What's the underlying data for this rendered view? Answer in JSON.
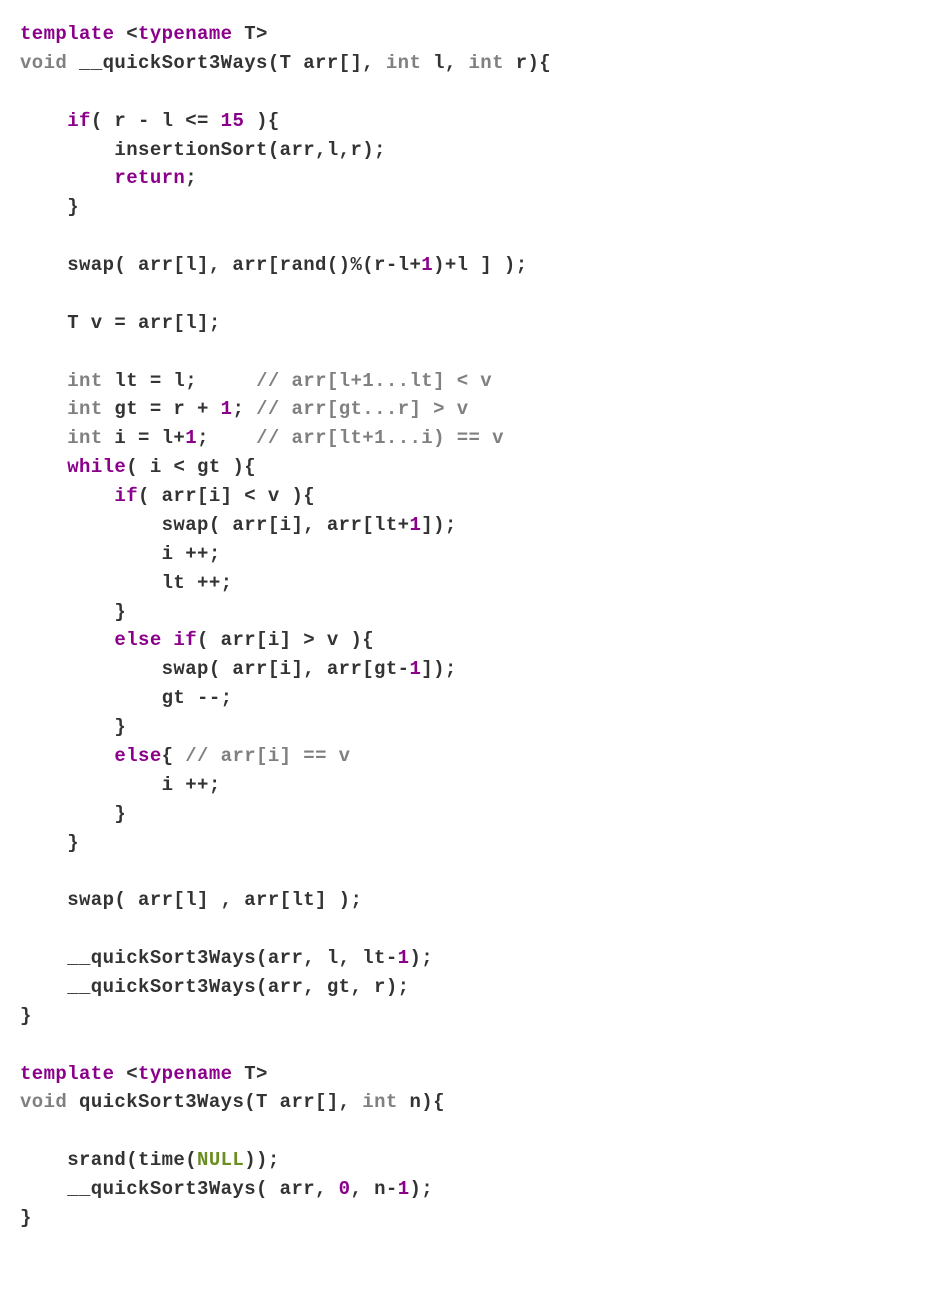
{
  "code": {
    "lines": [
      [
        [
          "kw",
          "template"
        ],
        [
          "txt",
          " <"
        ],
        [
          "kw",
          "typename"
        ],
        [
          "txt",
          " T>"
        ]
      ],
      [
        [
          "ty",
          "void"
        ],
        [
          "txt",
          " __quickSort3Ways(T arr[], "
        ],
        [
          "ty",
          "int"
        ],
        [
          "txt",
          " l, "
        ],
        [
          "ty",
          "int"
        ],
        [
          "txt",
          " r){"
        ]
      ],
      [
        [
          "txt",
          ""
        ]
      ],
      [
        [
          "txt",
          "    "
        ],
        [
          "kw",
          "if"
        ],
        [
          "txt",
          "( r - l <= "
        ],
        [
          "num",
          "15"
        ],
        [
          "txt",
          " ){"
        ]
      ],
      [
        [
          "txt",
          "        insertionSort(arr,l,r);"
        ]
      ],
      [
        [
          "txt",
          "        "
        ],
        [
          "kw",
          "return"
        ],
        [
          "txt",
          ";"
        ]
      ],
      [
        [
          "txt",
          "    }"
        ]
      ],
      [
        [
          "txt",
          ""
        ]
      ],
      [
        [
          "txt",
          "    swap( arr[l], arr[rand()%(r-l+"
        ],
        [
          "num",
          "1"
        ],
        [
          "txt",
          ")+l ] );"
        ]
      ],
      [
        [
          "txt",
          ""
        ]
      ],
      [
        [
          "txt",
          "    T v = arr[l];"
        ]
      ],
      [
        [
          "txt",
          ""
        ]
      ],
      [
        [
          "txt",
          "    "
        ],
        [
          "ty",
          "int"
        ],
        [
          "txt",
          " lt = l;     "
        ],
        [
          "cm",
          "// arr[l+1...lt] < v"
        ]
      ],
      [
        [
          "txt",
          "    "
        ],
        [
          "ty",
          "int"
        ],
        [
          "txt",
          " gt = r + "
        ],
        [
          "num",
          "1"
        ],
        [
          "txt",
          "; "
        ],
        [
          "cm",
          "// arr[gt...r] > v"
        ]
      ],
      [
        [
          "txt",
          "    "
        ],
        [
          "ty",
          "int"
        ],
        [
          "txt",
          " i = l+"
        ],
        [
          "num",
          "1"
        ],
        [
          "txt",
          ";    "
        ],
        [
          "cm",
          "// arr[lt+1...i) == v"
        ]
      ],
      [
        [
          "txt",
          "    "
        ],
        [
          "kw",
          "while"
        ],
        [
          "txt",
          "( i < gt ){"
        ]
      ],
      [
        [
          "txt",
          "        "
        ],
        [
          "kw",
          "if"
        ],
        [
          "txt",
          "( arr[i] < v ){"
        ]
      ],
      [
        [
          "txt",
          "            swap( arr[i], arr[lt+"
        ],
        [
          "num",
          "1"
        ],
        [
          "txt",
          "]);"
        ]
      ],
      [
        [
          "txt",
          "            i ++;"
        ]
      ],
      [
        [
          "txt",
          "            lt ++;"
        ]
      ],
      [
        [
          "txt",
          "        }"
        ]
      ],
      [
        [
          "txt",
          "        "
        ],
        [
          "kw",
          "else if"
        ],
        [
          "txt",
          "( arr[i] > v ){"
        ]
      ],
      [
        [
          "txt",
          "            swap( arr[i], arr[gt-"
        ],
        [
          "num",
          "1"
        ],
        [
          "txt",
          "]);"
        ]
      ],
      [
        [
          "txt",
          "            gt --;"
        ]
      ],
      [
        [
          "txt",
          "        }"
        ]
      ],
      [
        [
          "txt",
          "        "
        ],
        [
          "kw",
          "else"
        ],
        [
          "txt",
          "{ "
        ],
        [
          "cm",
          "// arr[i] == v"
        ]
      ],
      [
        [
          "txt",
          "            i ++;"
        ]
      ],
      [
        [
          "txt",
          "        }"
        ]
      ],
      [
        [
          "txt",
          "    }"
        ]
      ],
      [
        [
          "txt",
          ""
        ]
      ],
      [
        [
          "txt",
          "    swap( arr[l] , arr[lt] );"
        ]
      ],
      [
        [
          "txt",
          ""
        ]
      ],
      [
        [
          "txt",
          "    __quickSort3Ways(arr, l, lt-"
        ],
        [
          "num",
          "1"
        ],
        [
          "txt",
          ");"
        ]
      ],
      [
        [
          "txt",
          "    __quickSort3Ways(arr, gt, r);"
        ]
      ],
      [
        [
          "txt",
          "}"
        ]
      ],
      [
        [
          "txt",
          ""
        ]
      ],
      [
        [
          "kw",
          "template"
        ],
        [
          "txt",
          " <"
        ],
        [
          "kw",
          "typename"
        ],
        [
          "txt",
          " T>"
        ]
      ],
      [
        [
          "ty",
          "void"
        ],
        [
          "txt",
          " quickSort3Ways(T arr[], "
        ],
        [
          "ty",
          "int"
        ],
        [
          "txt",
          " n){"
        ]
      ],
      [
        [
          "txt",
          ""
        ]
      ],
      [
        [
          "txt",
          "    srand(time("
        ],
        [
          "nul",
          "NULL"
        ],
        [
          "txt",
          "));"
        ]
      ],
      [
        [
          "txt",
          "    __quickSort3Ways( arr, "
        ],
        [
          "num",
          "0"
        ],
        [
          "txt",
          ", n-"
        ],
        [
          "num",
          "1"
        ],
        [
          "txt",
          ");"
        ]
      ],
      [
        [
          "txt",
          "}"
        ]
      ]
    ]
  }
}
